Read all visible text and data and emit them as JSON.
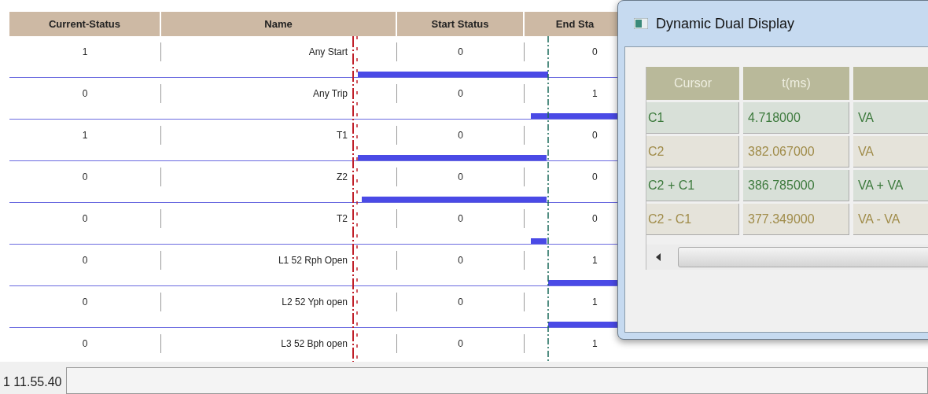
{
  "table": {
    "columns": [
      "Current-Status",
      "Name",
      "Start Status",
      "End Sta"
    ],
    "rows": [
      {
        "current_status": "1",
        "name": "Any Start",
        "start_status": "0",
        "end_status": "0"
      },
      {
        "current_status": "0",
        "name": "Any Trip",
        "start_status": "0",
        "end_status": "1"
      },
      {
        "current_status": "1",
        "name": "T1",
        "start_status": "0",
        "end_status": "0"
      },
      {
        "current_status": "0",
        "name": "Z2",
        "start_status": "0",
        "end_status": "0"
      },
      {
        "current_status": "0",
        "name": "T2",
        "start_status": "0",
        "end_status": "0"
      },
      {
        "current_status": "0",
        "name": "L1 52 Rph Open",
        "start_status": "0",
        "end_status": "1"
      },
      {
        "current_status": "0",
        "name": "L2 52 Yph open",
        "start_status": "0",
        "end_status": "1"
      },
      {
        "current_status": "0",
        "name": "L3 52 Bph open",
        "start_status": "0",
        "end_status": "1"
      }
    ]
  },
  "dialog": {
    "title": "Dynamic Dual Display",
    "columns": [
      "Cursor",
      "t(ms)"
    ],
    "rows": [
      {
        "cursor": "C1",
        "t_ms": "4.718000",
        "column_3": "VA",
        "color": "#3d7a3d"
      },
      {
        "cursor": "C2",
        "t_ms": "382.067000",
        "column_3": "VA",
        "color": "#a08c4a"
      },
      {
        "cursor": "C2 + C1",
        "t_ms": "386.785000",
        "column_3": "VA + VA",
        "color": "#3d7a3d"
      },
      {
        "cursor": "C2 - C1",
        "t_ms": "377.349000",
        "column_3": "VA - VA",
        "color": "#a08c4a"
      }
    ]
  },
  "status_bar": {
    "text": "1 11.55.40"
  }
}
